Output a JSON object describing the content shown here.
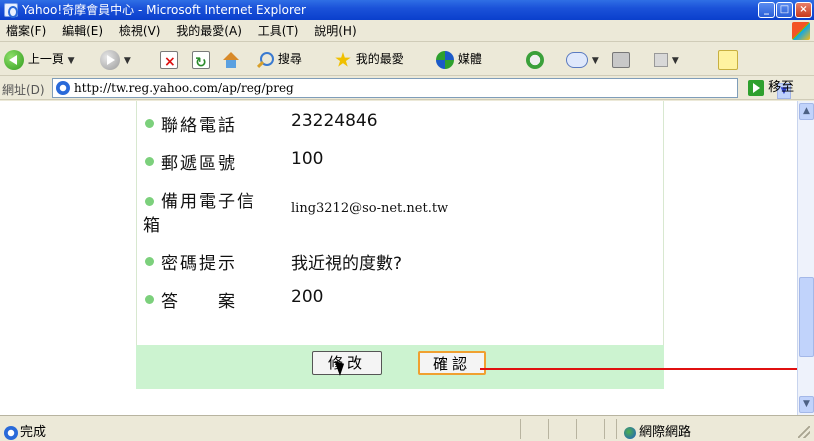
{
  "window": {
    "title": "Yahoo!奇摩會員中心 - Microsoft Internet Explorer",
    "title_bar_color": "#0a3fcc"
  },
  "menu": [
    {
      "label": "檔案(F)"
    },
    {
      "label": "編輯(E)"
    },
    {
      "label": "檢視(V)"
    },
    {
      "label": "我的最愛(A)"
    },
    {
      "label": "工具(T)"
    },
    {
      "label": "說明(H)"
    }
  ],
  "toolbar": {
    "back_label": "上一頁",
    "search_label": "搜尋",
    "favorites_label": "我的最愛",
    "media_label": "媒體"
  },
  "address": {
    "label": "網址(D)",
    "url": "http://tw.reg.yahoo.com/ap/reg/preg",
    "go_label": "移至"
  },
  "form": {
    "rows": [
      {
        "label": "聯絡電話",
        "value": "23224846"
      },
      {
        "label": "郵遞區號",
        "value": "100"
      },
      {
        "label_line1": "備用電子信",
        "label_line2": "箱",
        "value": "ling3212@so-net.net.tw"
      },
      {
        "label": "密碼提示",
        "value": "我近視的度數?"
      },
      {
        "label": "答　　案",
        "value": "200"
      }
    ],
    "edit_button": "修改",
    "confirm_button": "確認",
    "bullet_color": "#7cd07c",
    "button_bar_color": "#ccf3d0",
    "annotation_line_color": "#e01010"
  },
  "status": {
    "text": "完成",
    "zone": "網際網路"
  }
}
